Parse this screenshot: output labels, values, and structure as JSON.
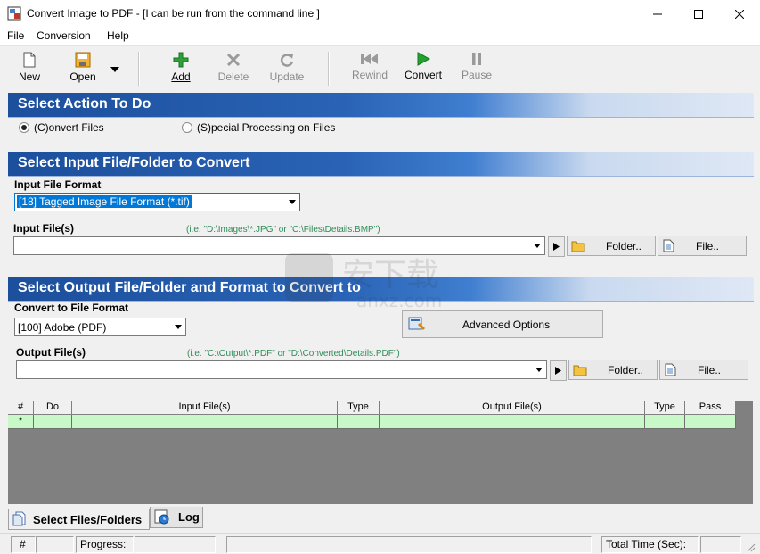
{
  "window": {
    "title": "Convert Image to PDF - [I can be run from the command line ]",
    "controls": {
      "minimize": "—",
      "maximize": "☐",
      "close": "✕"
    }
  },
  "menu": [
    "File",
    "Conversion",
    "Help"
  ],
  "toolbar": {
    "new": "New",
    "open": "Open",
    "add": "Add",
    "delete": "Delete",
    "update": "Update",
    "rewind": "Rewind",
    "convert": "Convert",
    "pause": "Pause"
  },
  "action_section": {
    "title": "Select Action To Do",
    "option_convert": "(C)onvert Files",
    "option_special": "(S)pecial Processing on Files",
    "selected": "convert"
  },
  "input_section": {
    "title": "Select Input File/Folder to Convert",
    "format_label": "Input File Format",
    "format_value": "[18] Tagged Image File Format (*.tif)",
    "files_label": "Input File(s)",
    "files_hint": "(i.e. \"D:\\Images\\*.JPG\" or \"C:\\Files\\Details.BMP\")",
    "files_value": "",
    "folder_button": "Folder..",
    "file_button": "File.."
  },
  "output_section": {
    "title": "Select Output File/Folder and Format to Convert to",
    "format_label": "Convert to File Format",
    "format_value": "[100] Adobe (PDF)",
    "advanced_button": "Advanced Options",
    "files_label": "Output File(s)",
    "files_hint": "(i.e. \"C:\\Output\\*.PDF\" or \"D:\\Converted\\Details.PDF\")",
    "files_value": "",
    "folder_button": "Folder..",
    "file_button": "File.."
  },
  "grid": {
    "columns": [
      "#",
      "Do",
      "Input File(s)",
      "Type",
      "Output File(s)",
      "Type",
      "Pass"
    ],
    "new_row_marker": "*"
  },
  "tabs": {
    "files": "Select Files/Folders",
    "log": "Log",
    "active": "files"
  },
  "statusbar": {
    "hash": "#",
    "progress_label": "Progress:",
    "total_time_label": "Total Time (Sec):"
  },
  "watermark": {
    "text": "安下载",
    "sub": "anxz.com"
  },
  "colors": {
    "section_blue": "#1c4f9c",
    "grid_row": "#c8f7c8",
    "hint": "#2e8b57",
    "selection": "#0078d7"
  }
}
